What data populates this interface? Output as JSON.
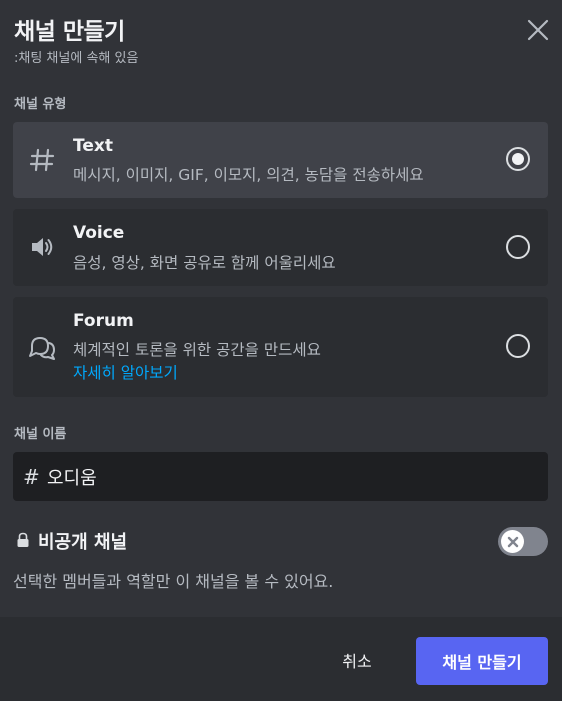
{
  "dialog": {
    "title": "채널 만들기",
    "subtitle": ":채팅 채널에 속해 있음",
    "close_icon": "close-icon"
  },
  "channel_type": {
    "label": "채널 유형",
    "selected": "text",
    "options": [
      {
        "id": "text",
        "icon": "hash-icon",
        "name": "Text",
        "description": "메시지, 이미지, GIF, 이모지, 의견, 농담을 전송하세요",
        "checked": true
      },
      {
        "id": "voice",
        "icon": "speaker-icon",
        "name": "Voice",
        "description": "음성, 영상, 화면 공유로 함께 어울리세요",
        "checked": false
      },
      {
        "id": "forum",
        "icon": "forum-icon",
        "name": "Forum",
        "description": "체계적인 토론을 위한 공간을 만드세요",
        "link": "자세히 알아보기",
        "checked": false
      }
    ]
  },
  "channel_name": {
    "label": "채널 이름",
    "prefix": "#",
    "value": "오디움"
  },
  "private": {
    "icon": "lock-icon",
    "title": "비공개 채널",
    "description": "선택한 멤버들과 역할만 이 채널을 볼 수 있어요.",
    "enabled": false
  },
  "footer": {
    "cancel_label": "취소",
    "create_label": "채널 만들기"
  },
  "colors": {
    "background": "#313338",
    "option_bg": "#2b2d31",
    "option_selected_bg": "#404249",
    "input_bg": "#1e1f22",
    "accent": "#5865f2",
    "link": "#00a8fc"
  }
}
